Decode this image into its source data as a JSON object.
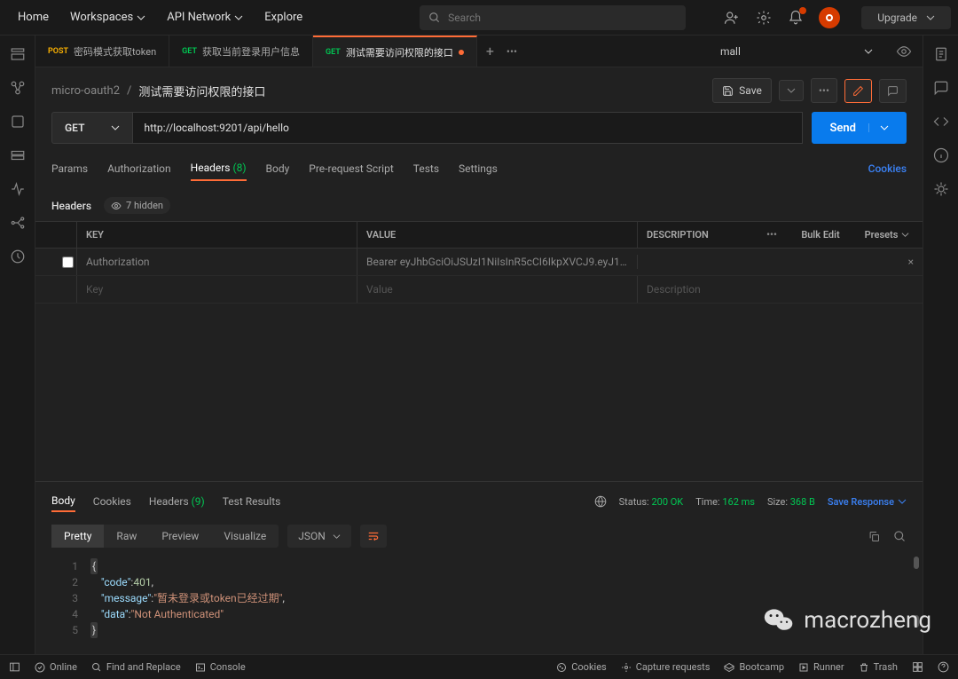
{
  "topnav": {
    "home": "Home",
    "workspaces": "Workspaces",
    "api_network": "API Network",
    "explore": "Explore",
    "search_placeholder": "Search",
    "upgrade": "Upgrade"
  },
  "tabs": [
    {
      "method": "POST",
      "title": "密码模式获取token"
    },
    {
      "method": "GET",
      "title": "获取当前登录用户信息"
    },
    {
      "method": "GET",
      "title": "测试需要访问权限的接口",
      "active": true,
      "dirty": true
    }
  ],
  "env": {
    "name": "mall"
  },
  "breadcrumb": {
    "collection": "micro-oauth2",
    "request": "测试需要访问权限的接口",
    "save": "Save"
  },
  "request": {
    "method": "GET",
    "url": "http://localhost:9201/api/hello",
    "send": "Send",
    "tabs": {
      "params": "Params",
      "authorization": "Authorization",
      "headers": "Headers",
      "headers_count": "(8)",
      "body": "Body",
      "prerequest": "Pre-request Script",
      "tests": "Tests",
      "settings": "Settings",
      "cookies": "Cookies"
    },
    "headers_label": "Headers",
    "hidden_label": "7 hidden",
    "table_head": {
      "key": "KEY",
      "value": "VALUE",
      "desc": "DESCRIPTION",
      "bulk": "Bulk Edit",
      "presets": "Presets"
    },
    "header_rows": [
      {
        "key": "Authorization",
        "value": "Bearer eyJhbGciOiJSUzI1NiIsInR5cCI6IkpXVCJ9.eyJ1c..."
      }
    ],
    "placeholder": {
      "key": "Key",
      "value": "Value",
      "desc": "Description"
    }
  },
  "response": {
    "tabs": {
      "body": "Body",
      "cookies": "Cookies",
      "headers": "Headers",
      "headers_count": "(9)",
      "tests": "Test Results"
    },
    "status_label": "Status:",
    "status": "200 OK",
    "time_label": "Time:",
    "time": "162 ms",
    "size_label": "Size:",
    "size": "368 B",
    "save_response": "Save Response",
    "views": {
      "pretty": "Pretty",
      "raw": "Raw",
      "preview": "Preview",
      "visualize": "Visualize",
      "format": "JSON"
    },
    "body": {
      "line1": "{",
      "code_key": "\"code\"",
      "code_val": "401",
      "msg_key": "\"message\"",
      "msg_val": "\"暂未登录或token已经过期\"",
      "data_key": "\"data\"",
      "data_val": "\"Not Authenticated\"",
      "line5": "}"
    }
  },
  "bottombar": {
    "online": "Online",
    "find": "Find and Replace",
    "console": "Console",
    "cookies": "Cookies",
    "capture": "Capture requests",
    "bootcamp": "Bootcamp",
    "runner": "Runner",
    "trash": "Trash"
  },
  "watermark": "macrozheng"
}
